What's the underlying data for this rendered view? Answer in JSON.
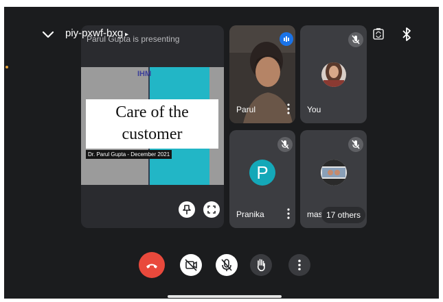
{
  "top_bar": {
    "meeting_code": "piy-pxwf-bxg",
    "collapse_icon": "chevron-down-icon",
    "rotate_icon": "camera-rotate-icon",
    "bluetooth_icon": "bluetooth-icon"
  },
  "presentation": {
    "label": "Parul Gupta is presenting",
    "slide_logo": "IHM",
    "slide_title_line1": "Care of the",
    "slide_title_line2": "customer",
    "slide_author": "Dr. Parul Gupta - December 2021",
    "pin_icon": "pin-icon",
    "fullscreen_icon": "fullscreen-icon"
  },
  "participants": [
    {
      "name": "Parul",
      "state": "speaking"
    },
    {
      "name": "You",
      "state": "muted"
    },
    {
      "name": "Pranika",
      "initial": "P",
      "state": "muted"
    },
    {
      "name": "mas",
      "state": "muted"
    }
  ],
  "others_badge": "17 others",
  "controls": {
    "end_call": "end-call-icon",
    "camera": "camera-off-icon",
    "mic": "mic-off-icon",
    "raise_hand": "hand-icon",
    "more": "more-vert-icon"
  },
  "colors": {
    "background": "#1b1c1e",
    "end_call": "#e9493c",
    "accent_blue": "#1a73e8",
    "slide_teal": "#22b6c6",
    "avatar_teal": "#14a8b8"
  }
}
